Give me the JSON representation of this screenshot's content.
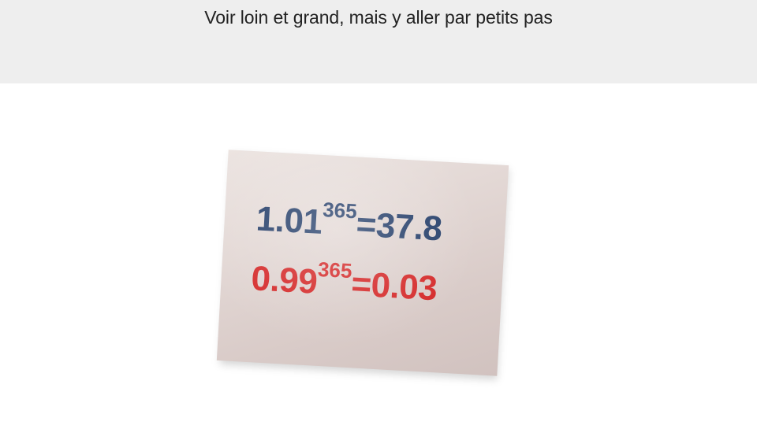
{
  "slide": {
    "title": "Voir loin et grand, mais y aller par petits pas"
  },
  "photo": {
    "line1": {
      "base": "1.01",
      "exponent": "365",
      "result": "=37.8",
      "color": "#27406b"
    },
    "line2": {
      "base": "0.99",
      "exponent": "365",
      "result": "=0.03",
      "color": "#d52b2b"
    }
  }
}
